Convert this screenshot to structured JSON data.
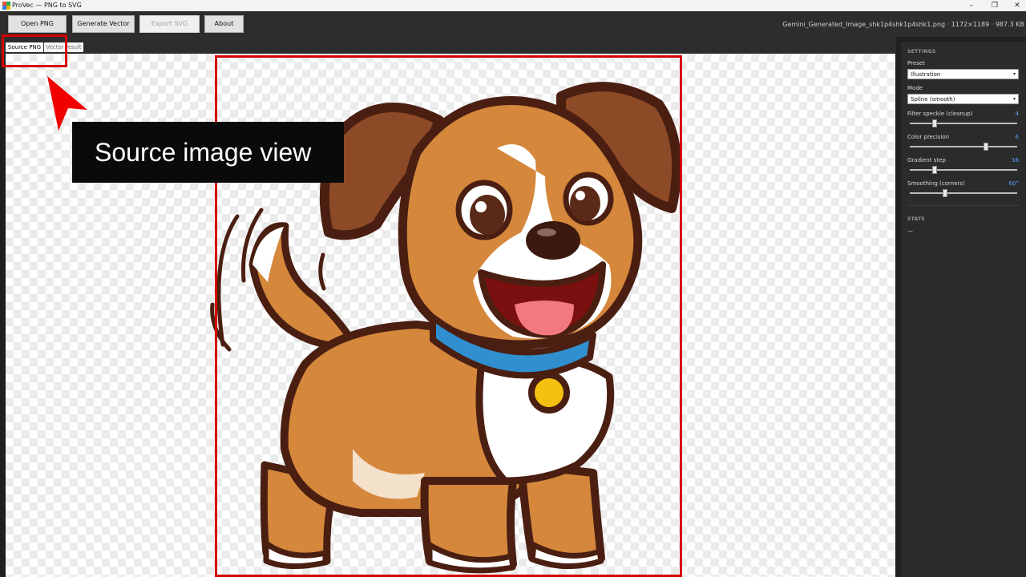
{
  "window": {
    "title": "ProVec — PNG to SVG",
    "icon": "app-icon",
    "controls": [
      "minimize-icon",
      "restore-icon",
      "close-icon"
    ]
  },
  "toolbar": {
    "open_label": "Open PNG",
    "generate_label": "Generate Vector",
    "export_label": "Export SVG",
    "about_label": "About",
    "file_info": "Gemini_Generated_Image_shk1p4shk1p4shk1.png · 1172×1189 · 987.3 KB"
  },
  "tabs": {
    "source": "Source PNG",
    "vector": "Vector result",
    "active": "source"
  },
  "annotation": {
    "callout": "Source image view",
    "color": "#d40000"
  },
  "settings": {
    "heading": "SETTINGS",
    "preset_label": "Preset",
    "preset_value": "Illustration",
    "mode_label": "Mode",
    "mode_value": "Spline (smooth)",
    "sliders": [
      {
        "label": "Filter speckle (cleanup)",
        "value": "4",
        "level": 0.22
      },
      {
        "label": "Color precision",
        "value": "6",
        "level": 0.72
      },
      {
        "label": "Gradient step",
        "value": "16",
        "level": 0.22
      },
      {
        "label": "Smoothing (corners)",
        "value": "60°",
        "level": 0.32
      }
    ]
  },
  "stats": {
    "heading": "STATS",
    "value": "—"
  },
  "colors": {
    "accent": "#5aa0ff",
    "panel": "#2b2b2b",
    "toolbar": "#2d2d2d",
    "highlight": "#d40000"
  }
}
